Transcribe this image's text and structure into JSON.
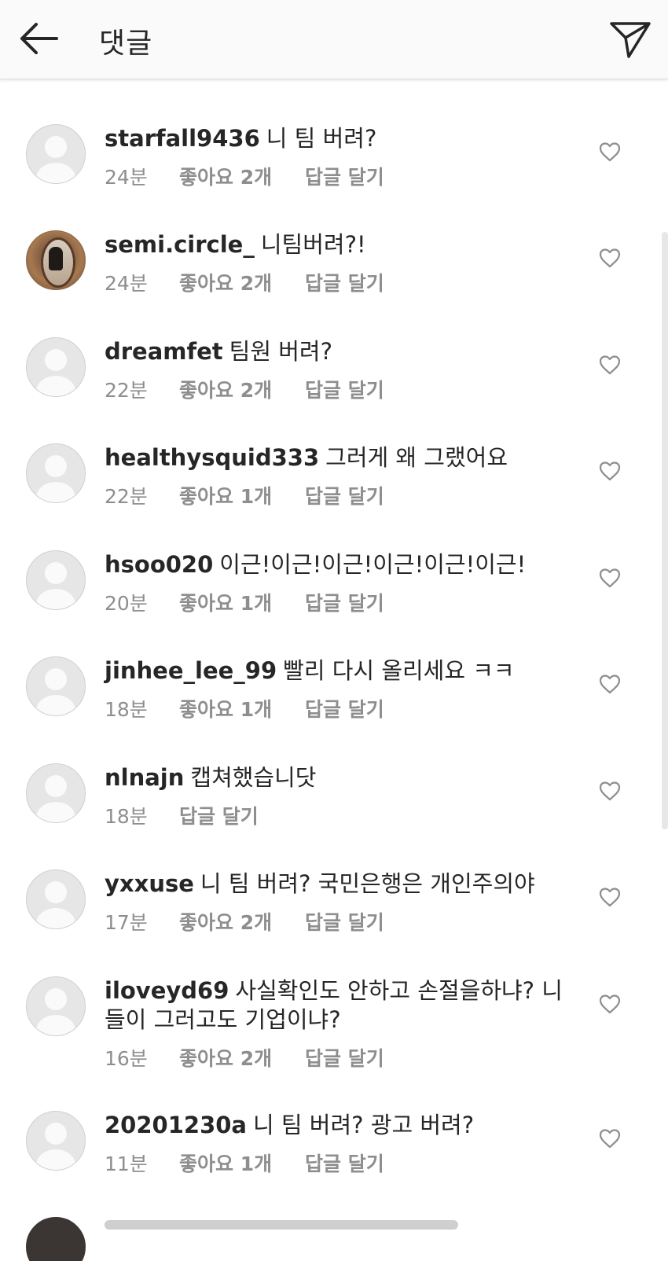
{
  "header": {
    "title": "댓글",
    "back_icon": "arrow-left-icon",
    "send_icon": "paper-plane-icon"
  },
  "comments": [
    {
      "user": "starfall9436",
      "text": "니 팀 버려?",
      "time": "24분",
      "likes": "좋아요 2개",
      "reply": "답글 달기",
      "avatar": "default"
    },
    {
      "user": "semi.circle_",
      "text": "니팀버려?!",
      "time": "24분",
      "likes": "좋아요 2개",
      "reply": "답글 달기",
      "avatar": "photo"
    },
    {
      "user": "dreamfet",
      "text": "팀원 버려?",
      "time": "22분",
      "likes": "좋아요 2개",
      "reply": "답글 달기",
      "avatar": "default"
    },
    {
      "user": "healthysquid333",
      "text": "그러게 왜 그랬어요",
      "time": "22분",
      "likes": "좋아요 1개",
      "reply": "답글 달기",
      "avatar": "default"
    },
    {
      "user": "hsoo020",
      "text": "이근!이근!이근!이근!이근!이근!",
      "time": "20분",
      "likes": "좋아요 1개",
      "reply": "답글 달기",
      "avatar": "default"
    },
    {
      "user": "jinhee_lee_99",
      "text": "빨리 다시 올리세요 ㅋㅋ",
      "time": "18분",
      "likes": "좋아요 1개",
      "reply": "답글 달기",
      "avatar": "default"
    },
    {
      "user": "nlnajn",
      "text": "캡쳐했습니닷",
      "time": "18분",
      "likes": "",
      "reply": "답글 달기",
      "avatar": "default"
    },
    {
      "user": "yxxuse",
      "text": "니 팀 버려? 국민은행은 개인주의야",
      "time": "17분",
      "likes": "좋아요 2개",
      "reply": "답글 달기",
      "avatar": "default"
    },
    {
      "user": "iloveyd69",
      "text": "사실확인도 안하고 손절을하냐? 니들이 그러고도 기업이냐?",
      "time": "16분",
      "likes": "좋아요 2개",
      "reply": "답글 달기",
      "avatar": "default"
    },
    {
      "user": "20201230a",
      "text": "니 팀 버려? 광고 버려?",
      "time": "11분",
      "likes": "좋아요 1개",
      "reply": "답글 달기",
      "avatar": "default"
    }
  ]
}
